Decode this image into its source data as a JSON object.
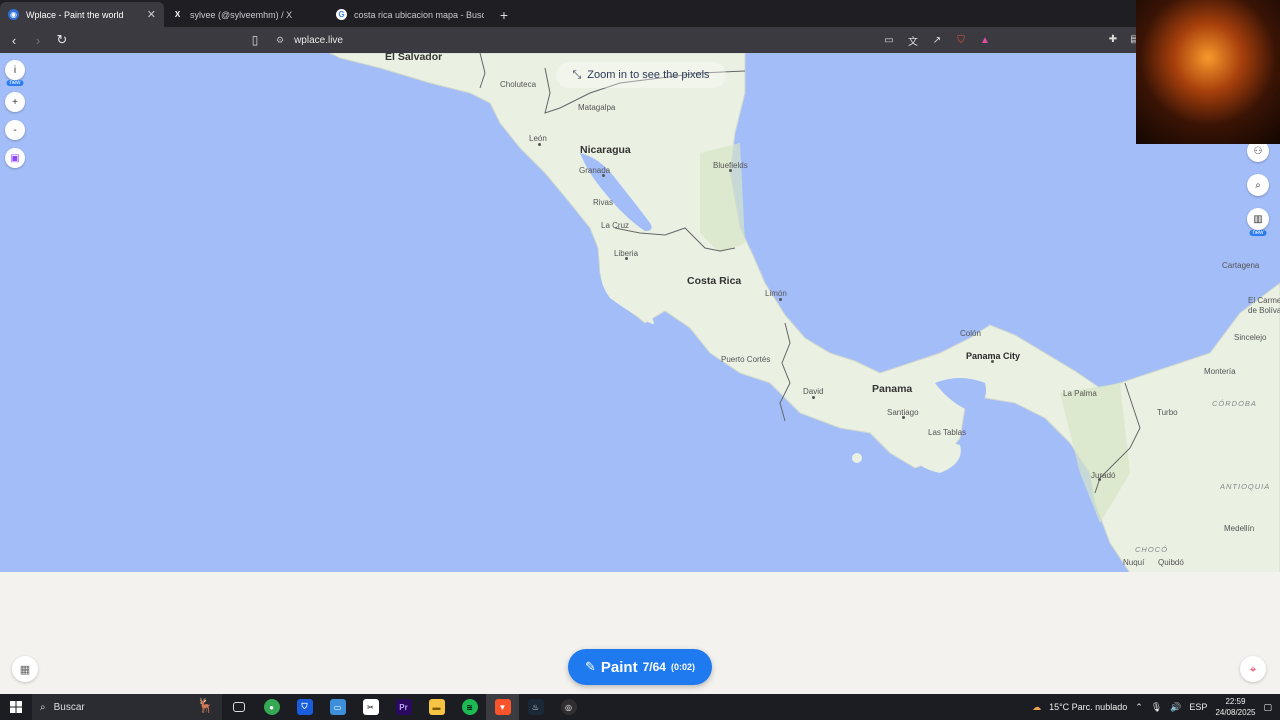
{
  "browser": {
    "tabs": [
      {
        "title": "Wplace - Paint the world",
        "active": true,
        "icon": "globe-icon"
      },
      {
        "title": "sylvee (@sylveemhm) / X",
        "active": false,
        "icon": "x-icon"
      },
      {
        "title": "costa rica ubicacion mapa - Buscar c",
        "active": false,
        "icon": "google-icon"
      }
    ],
    "url": "wplace.live"
  },
  "map": {
    "zoom_hint": "Zoom in to see the pixels",
    "labels": {
      "el_salvador": "El Salvador",
      "choluteca": "Choluteca",
      "matagalpa": "Matagalpa",
      "leon": "León",
      "nicaragua": "Nicaragua",
      "granada": "Granada",
      "bluefields": "Bluefields",
      "rivas": "Rivas",
      "la_cruz": "La Cruz",
      "liberia": "Liberia",
      "costa_rica": "Costa Rica",
      "limon": "Limón",
      "puerto_cortes": "Puerto Cortés",
      "colon": "Colón",
      "panama_city": "Panama City",
      "david": "David",
      "panama": "Panama",
      "santiago": "Santiago",
      "las_tablas": "Las Tablas",
      "la_palma": "La Palma",
      "jurado": "Juradó",
      "cartagena": "Cartagena",
      "el_carmen": "El Carme",
      "de_bolivar": "de Bolíva",
      "sincelejo": "Sincelejo",
      "monteria": "Montería",
      "turbo": "Turbo",
      "cordoba": "CÓRDOBA",
      "antioquia": "ANTIOQUIA",
      "medellin": "Medellín",
      "choco": "CHOCÓ",
      "nuqui": "Nuquí",
      "quibdo": "Quibdó"
    }
  },
  "left_tools": {
    "info": "i",
    "info_badge": "new",
    "zoom_in": "+",
    "zoom_out": "-"
  },
  "right_tools": {
    "leaderboard_badge": "new"
  },
  "paint_button": {
    "label": "Paint",
    "count": "7/64",
    "timer": "(0:02)"
  },
  "taskbar": {
    "search_placeholder": "Buscar",
    "weather": "15°C  Parc. nublado",
    "language": "ESP",
    "time": "22:59",
    "date": "24/08/2025"
  },
  "colors": {
    "ocean": "#a2bdf8",
    "land": "#eaf0e2",
    "paint_button": "#1f7af0"
  }
}
